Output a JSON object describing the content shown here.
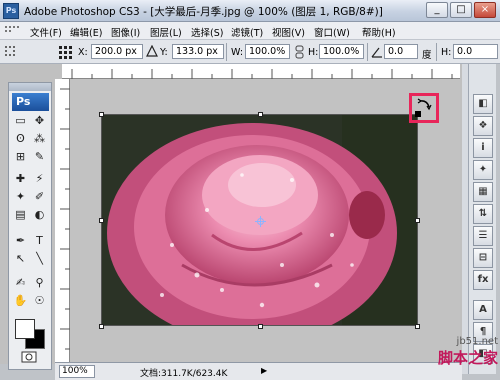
{
  "window": {
    "app_name": "Adobe Photoshop CS3",
    "title": "Adobe Photoshop CS3 - [大学最后-月季.jpg @ 100% (图层 1, RGB/8#)]",
    "minimize": "_",
    "maximize": "□",
    "close": "×"
  },
  "menu": {
    "items": [
      "文件(F)",
      "编辑(E)",
      "图像(I)",
      "图层(L)",
      "选择(S)",
      "滤镜(T)",
      "视图(V)",
      "窗口(W)",
      "帮助(H)"
    ]
  },
  "options": {
    "x_label": "X:",
    "x_value": "200.0 px",
    "y_label": "Y:",
    "y_value": "133.0 px",
    "w_label": "W:",
    "w_value": "100.0%",
    "h_label": "H:",
    "h_value": "100.0%",
    "angle_value": "0.0",
    "angle_unit": "度",
    "hskew_label": "H:",
    "hskew_value": "0.0"
  },
  "tools": {
    "badge": "Ps",
    "glyphs": [
      "▭",
      "✥",
      "ʘ",
      "⁂",
      "⊞",
      "✎",
      "✚",
      "⚡",
      "✦",
      "✐",
      "▤",
      "◐",
      "✒",
      "T",
      "↖",
      "╲",
      "✍",
      "✋",
      "⚲",
      "☉"
    ]
  },
  "dock": {
    "buttons": [
      "◧",
      "❖",
      "i",
      "✦",
      "▦",
      "⇅",
      "☰",
      "⊟",
      "fx",
      "A",
      "¶",
      "◧"
    ]
  },
  "status": {
    "zoom": "100%",
    "doc_info": "文档:311.7K/623.4K",
    "arrow": "▶"
  },
  "watermark": {
    "site": "jb51.net",
    "text": "脚本之家"
  },
  "colors": {
    "highlight": "#e8265a",
    "ps_badge": "#1b4f9a"
  }
}
